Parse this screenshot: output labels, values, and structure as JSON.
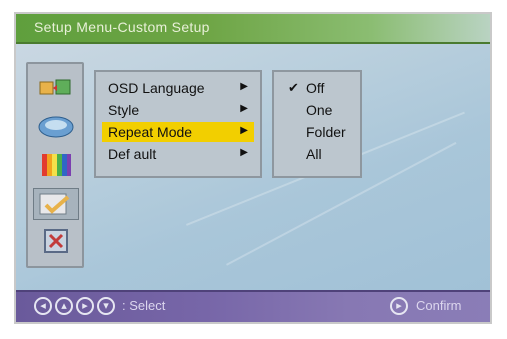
{
  "title_bar": {
    "title": "Setup Menu-Custom Setup"
  },
  "sidebar": {
    "icons": [
      {
        "name": "language-settings-icon",
        "active": false
      },
      {
        "name": "video-settings-icon",
        "active": false
      },
      {
        "name": "color-bars-icon",
        "active": false
      },
      {
        "name": "custom-setup-icon",
        "active": true
      },
      {
        "name": "exit-icon",
        "active": false
      }
    ]
  },
  "menu": {
    "items": [
      {
        "label": "OSD Language"
      },
      {
        "label": "Style"
      },
      {
        "label": "Repeat Mode",
        "selected": true
      },
      {
        "label": "Def ault"
      }
    ]
  },
  "options": {
    "items": [
      {
        "label": "Off",
        "checked": true
      },
      {
        "label": "One"
      },
      {
        "label": "Folder"
      },
      {
        "label": "All"
      }
    ]
  },
  "bottom_bar": {
    "nav_icons": [
      "left-arrow-icon",
      "up-arrow-icon",
      "right-arrow-icon",
      "down-arrow-icon"
    ],
    "select_label": ": Select",
    "confirm_label": "Confirm"
  },
  "colors": {
    "title_bar": "#6ea545",
    "selected_item": "#f2cf00",
    "bottom_bar": "#7766a8",
    "panel": "#bcc6ce"
  }
}
